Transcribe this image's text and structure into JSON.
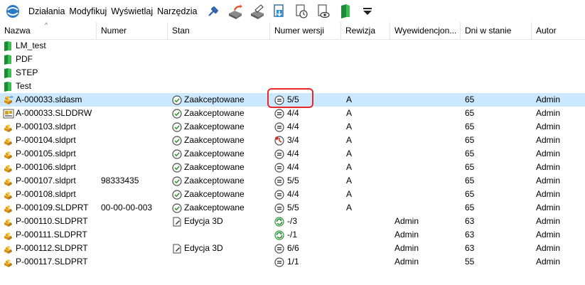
{
  "menu": [
    "Działania",
    "Modyfikuj",
    "Wyświetlaj",
    "Narzędzia"
  ],
  "toolbar_icons": [
    "pin-icon",
    "check-out-icon",
    "check-in-icon",
    "get-latest-icon",
    "get-version-icon",
    "preview-icon",
    "folder-icon",
    "dropdown-icon"
  ],
  "columns": [
    {
      "key": "name",
      "label": "Nazwa"
    },
    {
      "key": "number",
      "label": "Numer"
    },
    {
      "key": "state",
      "label": "Stan"
    },
    {
      "key": "version",
      "label": "Numer wersji"
    },
    {
      "key": "revision",
      "label": "Rewizja"
    },
    {
      "key": "checked_out",
      "label": "Wyewidencjon..."
    },
    {
      "key": "days",
      "label": "Dni w stanie"
    },
    {
      "key": "author",
      "label": "Autor"
    }
  ],
  "rows": [
    {
      "type": "folder",
      "name": "LM_test",
      "number": "",
      "state": "",
      "state_icon": "",
      "version": "",
      "version_icon": "",
      "revision": "",
      "checked_out": "",
      "days": "",
      "author": ""
    },
    {
      "type": "folder",
      "name": "PDF",
      "number": "",
      "state": "",
      "state_icon": "",
      "version": "",
      "version_icon": "",
      "revision": "",
      "checked_out": "",
      "days": "",
      "author": ""
    },
    {
      "type": "folder",
      "name": "STEP",
      "number": "",
      "state": "",
      "state_icon": "",
      "version": "",
      "version_icon": "",
      "revision": "",
      "checked_out": "",
      "days": "",
      "author": ""
    },
    {
      "type": "folder",
      "name": "Test",
      "number": "",
      "state": "",
      "state_icon": "",
      "version": "",
      "version_icon": "",
      "revision": "",
      "checked_out": "",
      "days": "",
      "author": ""
    },
    {
      "type": "assembly",
      "name": "A-000033.sldasm",
      "number": "",
      "state": "Zaakceptowane",
      "state_icon": "approved",
      "version": "5/5",
      "version_icon": "equal",
      "revision": "A",
      "checked_out": "",
      "days": "65",
      "author": "Admin",
      "selected": true
    },
    {
      "type": "drawing",
      "name": "A-000033.SLDDRW",
      "number": "",
      "state": "Zaakceptowane",
      "state_icon": "approved",
      "version": "4/4",
      "version_icon": "equal",
      "revision": "A",
      "checked_out": "",
      "days": "65",
      "author": "Admin"
    },
    {
      "type": "part",
      "name": "P-000103.sldprt",
      "number": "",
      "state": "Zaakceptowane",
      "state_icon": "approved",
      "version": "4/4",
      "version_icon": "equal",
      "revision": "A",
      "checked_out": "",
      "days": "65",
      "author": "Admin"
    },
    {
      "type": "part",
      "name": "P-000104.sldprt",
      "number": "",
      "state": "Zaakceptowane",
      "state_icon": "approved",
      "version": "3/4",
      "version_icon": "outdated",
      "revision": "A",
      "checked_out": "",
      "days": "65",
      "author": "Admin"
    },
    {
      "type": "part",
      "name": "P-000105.sldprt",
      "number": "",
      "state": "Zaakceptowane",
      "state_icon": "approved",
      "version": "4/4",
      "version_icon": "equal",
      "revision": "A",
      "checked_out": "",
      "days": "65",
      "author": "Admin"
    },
    {
      "type": "part",
      "name": "P-000106.sldprt",
      "number": "",
      "state": "Zaakceptowane",
      "state_icon": "approved",
      "version": "4/4",
      "version_icon": "equal",
      "revision": "A",
      "checked_out": "",
      "days": "65",
      "author": "Admin"
    },
    {
      "type": "part",
      "name": "P-000107.sldprt",
      "number": "98333435",
      "state": "Zaakceptowane",
      "state_icon": "approved",
      "version": "5/5",
      "version_icon": "equal",
      "revision": "A",
      "checked_out": "",
      "days": "65",
      "author": "Admin"
    },
    {
      "type": "part",
      "name": "P-000108.sldprt",
      "number": "",
      "state": "Zaakceptowane",
      "state_icon": "approved",
      "version": "4/4",
      "version_icon": "equal",
      "revision": "A",
      "checked_out": "",
      "days": "65",
      "author": "Admin"
    },
    {
      "type": "part",
      "name": "P-000109.SLDPRT",
      "number": "00-00-00-003",
      "state": "Zaakceptowane",
      "state_icon": "approved",
      "version": "5/5",
      "version_icon": "equal",
      "revision": "A",
      "checked_out": "",
      "days": "65",
      "author": "Admin"
    },
    {
      "type": "part",
      "name": "P-000110.SLDPRT",
      "number": "",
      "state": "Edycja 3D",
      "state_icon": "edit",
      "version": "-/3",
      "version_icon": "checked-out",
      "revision": "",
      "checked_out": "Admin",
      "days": "63",
      "author": "Admin"
    },
    {
      "type": "part",
      "name": "P-000111.SLDPRT",
      "number": "",
      "state": "",
      "state_icon": "",
      "version": "-/1",
      "version_icon": "checked-out",
      "revision": "",
      "checked_out": "Admin",
      "days": "63",
      "author": "Admin"
    },
    {
      "type": "part",
      "name": "P-000112.SLDPRT",
      "number": "",
      "state": "Edycja 3D",
      "state_icon": "edit",
      "version": "6/6",
      "version_icon": "equal",
      "revision": "",
      "checked_out": "Admin",
      "days": "63",
      "author": "Admin"
    },
    {
      "type": "part",
      "name": "P-000117.SLDPRT",
      "number": "",
      "state": "",
      "state_icon": "",
      "version": "1/1",
      "version_icon": "equal",
      "revision": "",
      "checked_out": "Admin",
      "days": "55",
      "author": "Admin"
    }
  ],
  "colors": {
    "selection": "#cce8ff",
    "highlight": "#e8282b",
    "folder": "#2e9e3e",
    "part": "#e3a21a"
  }
}
